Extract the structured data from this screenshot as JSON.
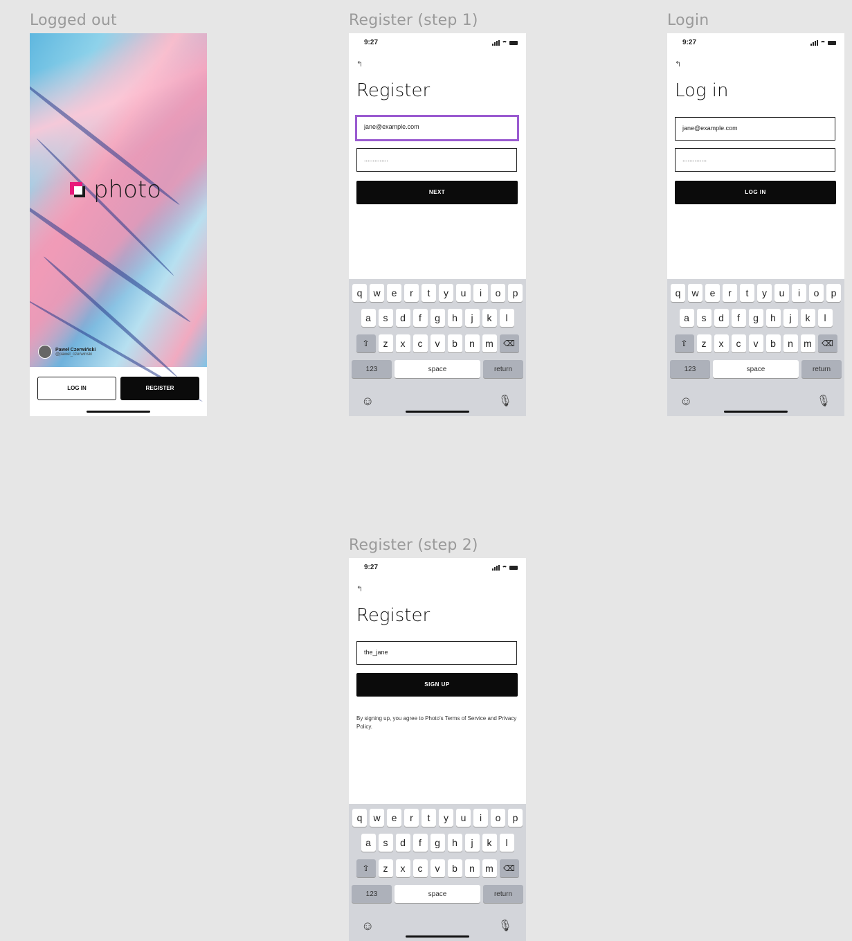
{
  "frames": {
    "logged_out": {
      "label": "Logged out"
    },
    "register1": {
      "label": "Register (step 1)"
    },
    "login": {
      "label": "Login"
    },
    "register2": {
      "label": "Register (step 2)"
    }
  },
  "status": {
    "time": "9:27"
  },
  "logged_out": {
    "brand": "photo",
    "credit_name": "Paweł Czerwiński",
    "credit_sub": "@pawel_czerwinski",
    "login_button": "LOG IN",
    "register_button": "REGISTER"
  },
  "register1": {
    "title": "Register",
    "email_value": "jane@example.com",
    "password_value": "..............",
    "next_button": "NEXT"
  },
  "login": {
    "title": "Log in",
    "email_value": "jane@example.com",
    "password_value": "..............",
    "login_button": "LOG IN"
  },
  "register2": {
    "title": "Register",
    "username_value": "the_jane",
    "signup_button": "SIGN UP",
    "terms_text": "By signing up, you agree to Photo's Terms of Service and Privacy Policy."
  },
  "keyboard": {
    "row1": [
      "q",
      "w",
      "e",
      "r",
      "t",
      "y",
      "u",
      "i",
      "o",
      "p"
    ],
    "row2": [
      "a",
      "s",
      "d",
      "f",
      "g",
      "h",
      "j",
      "k",
      "l"
    ],
    "row3": [
      "z",
      "x",
      "c",
      "v",
      "b",
      "n",
      "m"
    ],
    "numbers_key": "123",
    "space_key": "space",
    "return_key": "return"
  },
  "icons": [
    "back-arrow-icon",
    "signal-icon",
    "wifi-icon",
    "battery-icon",
    "shift-icon",
    "delete-icon",
    "emoji-icon",
    "mic-icon"
  ]
}
